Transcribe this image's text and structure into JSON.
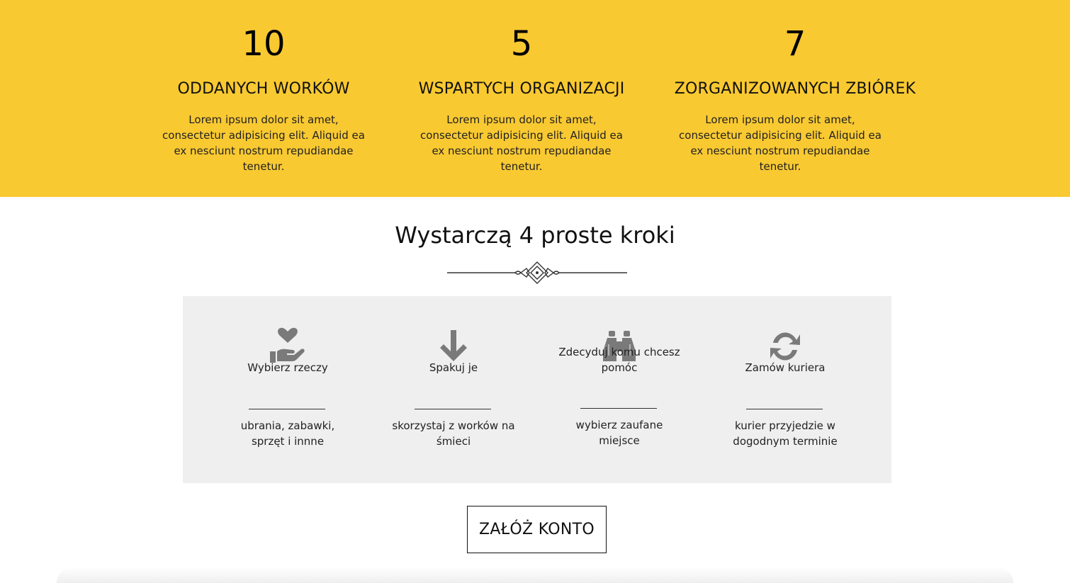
{
  "stats": [
    {
      "number": "10",
      "title": "ODDANYCH WORKÓW",
      "description": "Lorem ipsum dolor sit amet, consectetur adipisicing elit. Aliquid ea ex nesciunt nostrum repudiandae tenetur."
    },
    {
      "number": "5",
      "title": "WSPARTYCH ORGANIZACJI",
      "description": "Lorem ipsum dolor sit amet, consectetur adipisicing elit. Aliquid ea ex nesciunt nostrum repudiandae tenetur."
    },
    {
      "number": "7",
      "title": "ZORGANIZOWANYCH ZBIÓREK",
      "description": "Lorem ipsum dolor sit amet, consectetur adipisicing elit. Aliquid ea ex nesciunt nostrum repudiandae tenetur."
    }
  ],
  "steps_section": {
    "title": "Wystarczą 4 proste kroki",
    "steps": [
      {
        "icon": "hand-heart-icon",
        "title": "Wybierz rzeczy",
        "description": "ubrania, zabawki, sprzęt i innne"
      },
      {
        "icon": "arrow-down-icon",
        "title": "Spakuj je",
        "description": "skorzystaj z worków na śmieci"
      },
      {
        "icon": "binoculars-icon",
        "title": "Zdecyduj komu chcesz pomóc",
        "description": "wybierz zaufane miejsce"
      },
      {
        "icon": "refresh-icon",
        "title": "Zamów kuriera",
        "description": "kurier przyjedzie w dogodnym terminie"
      }
    ]
  },
  "cta": {
    "label": "ZAŁÓŻ KONTO"
  },
  "colors": {
    "accent_yellow": "#f9c931",
    "panel_gray": "#eeefee",
    "icon_gray": "#7a7a7a"
  }
}
